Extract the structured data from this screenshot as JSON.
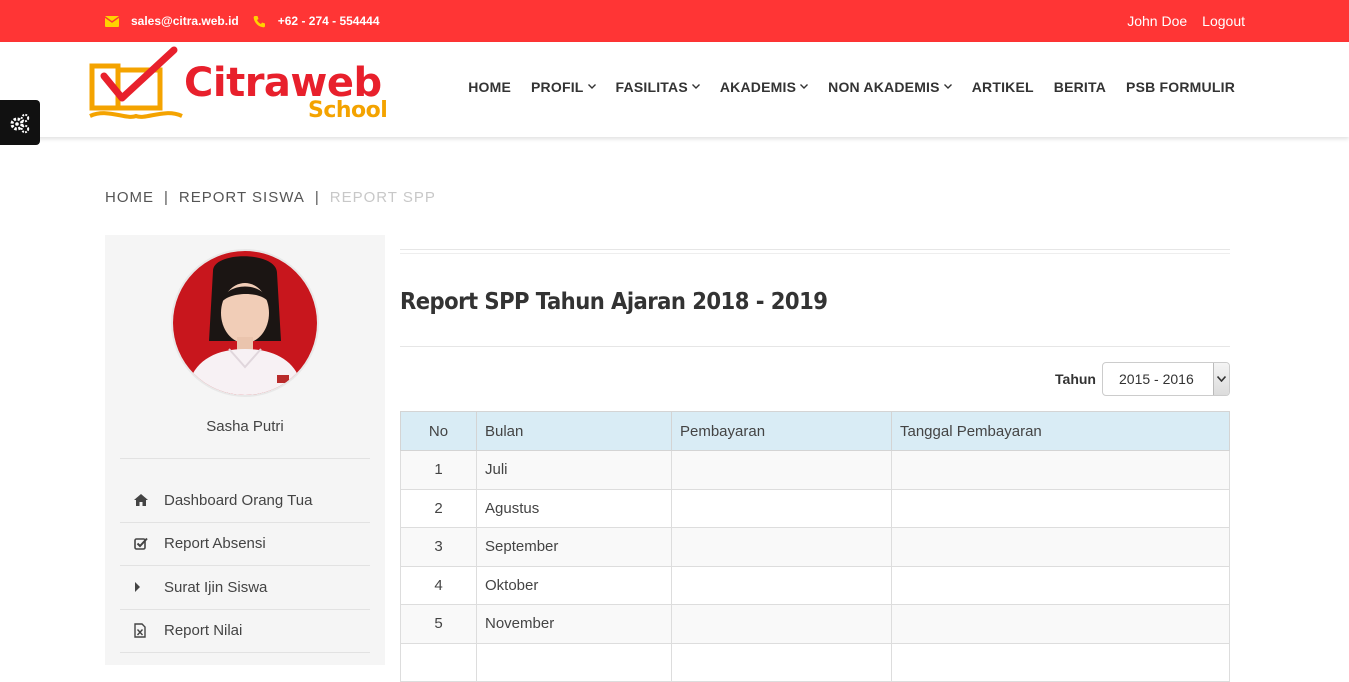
{
  "topbar": {
    "email": "sales@citra.web.id",
    "phone": "+62 - 274 - 554444",
    "user_name": "John Doe",
    "logout_label": "Logout"
  },
  "logo": {
    "brand": "Citraweb",
    "sub": "School"
  },
  "nav": {
    "items": [
      {
        "label": "HOME",
        "dropdown": false
      },
      {
        "label": "PROFIL",
        "dropdown": true
      },
      {
        "label": "FASILITAS",
        "dropdown": true
      },
      {
        "label": "AKADEMIS",
        "dropdown": true
      },
      {
        "label": "NON AKADEMIS",
        "dropdown": true
      },
      {
        "label": "ARTIKEL",
        "dropdown": false
      },
      {
        "label": "BERITA",
        "dropdown": false
      },
      {
        "label": "PSB FORMULIR",
        "dropdown": false
      }
    ]
  },
  "breadcrumb": {
    "items": [
      "HOME",
      "REPORT SISWA",
      "REPORT SPP"
    ],
    "separator": "|"
  },
  "sidebar": {
    "student_name": "Sasha Putri",
    "menu": [
      {
        "label": "Dashboard Orang Tua",
        "icon": "home-icon"
      },
      {
        "label": "Report Absensi",
        "icon": "check-square-icon"
      },
      {
        "label": "Surat Ijin Siswa",
        "icon": "caret-right-icon"
      },
      {
        "label": "Report Nilai",
        "icon": "file-excel-icon"
      }
    ]
  },
  "main": {
    "title": "Report SPP Tahun Ajaran 2018 - 2019",
    "filter_label": "Tahun",
    "year_selected": "2015 - 2016"
  },
  "table": {
    "headers": [
      "No",
      "Bulan",
      "Pembayaran",
      "Tanggal Pembayaran"
    ],
    "rows": [
      {
        "no": "1",
        "bulan": "Juli",
        "pembayaran": "",
        "tanggal": ""
      },
      {
        "no": "2",
        "bulan": "Agustus",
        "pembayaran": "",
        "tanggal": ""
      },
      {
        "no": "3",
        "bulan": "September",
        "pembayaran": "",
        "tanggal": ""
      },
      {
        "no": "4",
        "bulan": "Oktober",
        "pembayaran": "",
        "tanggal": ""
      },
      {
        "no": "5",
        "bulan": "November",
        "pembayaran": "",
        "tanggal": ""
      },
      {
        "no": "",
        "bulan": "",
        "pembayaran": "",
        "tanggal": ""
      }
    ]
  },
  "colors": {
    "topbar": "#ff3535",
    "accent_icon": "#ffd200",
    "table_header": "#d9ecf5",
    "brand_red": "#e8202c",
    "brand_orange": "#f4a300"
  }
}
